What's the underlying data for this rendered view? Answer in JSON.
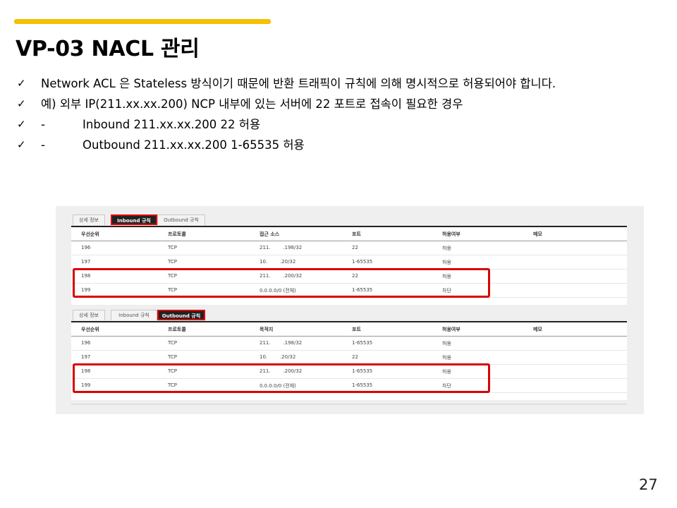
{
  "slide": {
    "title": "VP-03 NACL 관리",
    "bullets": [
      {
        "check": "✓",
        "prefix": "",
        "text": "Network ACL 은 Stateless 방식이기 때문에 반환 트래픽이 규칙에 의해 명시적으로 허용되어야 합니다."
      },
      {
        "check": "✓",
        "prefix": "",
        "text": "예) 외부 IP(211.xx.xx.200) NCP 내부에 있는 서버에 22 포트로 접속이 필요한 경우"
      },
      {
        "check": "✓",
        "prefix": "-",
        "text": "Inbound 211.xx.xx.200 22 허용"
      },
      {
        "check": "✓",
        "prefix": "-",
        "text": "Outbound 211.xx.xx.200 1-65535 허용"
      }
    ],
    "page_number": "27"
  },
  "inbound_panel": {
    "tabs": [
      "상세 정보",
      "Inbound 규칙",
      "Outbound 규칙"
    ],
    "active_tab": "Inbound 규칙",
    "headers": [
      "우선순위",
      "프로토콜",
      "접근 소스",
      "포트",
      "허용여부",
      "메모"
    ],
    "rows": [
      [
        "196",
        "TCP",
        "211.        .198/32",
        "22",
        "허용",
        ""
      ],
      [
        "197",
        "TCP",
        "10.        .20/32",
        "1-65535",
        "허용",
        ""
      ],
      [
        "198",
        "TCP",
        "211.        .200/32",
        "22",
        "허용",
        ""
      ],
      [
        "199",
        "TCP",
        "0.0.0.0/0 (전체)",
        "1-65535",
        "차단",
        ""
      ]
    ]
  },
  "outbound_panel": {
    "tabs": [
      "상세 정보",
      "Inbound 규칙",
      "Outbound 규칙"
    ],
    "active_tab": "Outbound 규칙",
    "headers": [
      "우선순위",
      "프로토콜",
      "목적지",
      "포트",
      "허용여부",
      "메모"
    ],
    "rows": [
      [
        "196",
        "TCP",
        "211.        .198/32",
        "1-65535",
        "허용",
        ""
      ],
      [
        "197",
        "TCP",
        "10.        .20/32",
        "22",
        "허용",
        ""
      ],
      [
        "198",
        "TCP",
        "211.        .200/32",
        "1-65535",
        "허용",
        ""
      ],
      [
        "199",
        "TCP",
        "0.0.0.0/0 (전체)",
        "1-65535",
        "차단",
        ""
      ]
    ]
  },
  "colors": {
    "accent": "#f5c000",
    "highlight": "#d90000",
    "tab_active_bg": "#222222"
  }
}
